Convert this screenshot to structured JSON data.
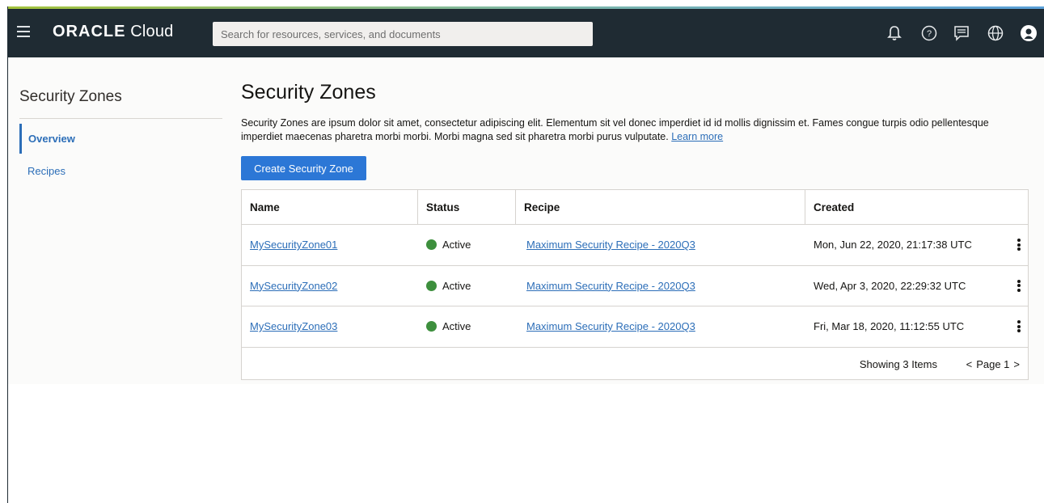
{
  "header": {
    "logo_brand": "ORACLE",
    "logo_product": "Cloud",
    "search_placeholder": "Search for resources, services, and documents",
    "icons": [
      "menu-icon",
      "bell-icon",
      "help-icon",
      "chat-icon",
      "globe-icon",
      "user-icon"
    ]
  },
  "sidebar": {
    "title": "Security Zones",
    "items": [
      {
        "label": "Overview",
        "active": true
      },
      {
        "label": "Recipes",
        "active": false
      }
    ]
  },
  "main": {
    "title": "Security Zones",
    "description": "Security Zones are ipsum dolor sit amet, consectetur adipiscing elit. Elementum sit vel donec imperdiet id id mollis dignissim et. Fames congue turpis odio pellentesque imperdiet maecenas pharetra morbi morbi. Morbi magna sed sit pharetra morbi purus vulputate.",
    "learn_more": "Learn more",
    "create_button": "Create Security Zone"
  },
  "table": {
    "columns": [
      "Name",
      "Status",
      "Recipe",
      "Created"
    ],
    "rows": [
      {
        "name": "MySecurityZone01",
        "status": "Active",
        "recipe": "Maximum Security Recipe - 2020Q3",
        "created": "Mon, Jun 22, 2020, 21:17:38 UTC"
      },
      {
        "name": "MySecurityZone02",
        "status": "Active",
        "recipe": "Maximum Security Recipe - 2020Q3",
        "created": "Wed, Apr 3, 2020, 22:29:32 UTC"
      },
      {
        "name": "MySecurityZone03",
        "status": "Active",
        "recipe": "Maximum Security Recipe - 2020Q3",
        "created": "Fri, Mar 18, 2020, 11:12:55 UTC"
      }
    ],
    "footer": {
      "showing": "Showing 3 Items",
      "prev": "<",
      "page_label": "Page 1",
      "next": ">"
    }
  },
  "colors": {
    "header_bg": "#1f2b33",
    "accent": "#2c77d6",
    "link": "#2c6eb8",
    "status_active": "#3d8f3d"
  }
}
